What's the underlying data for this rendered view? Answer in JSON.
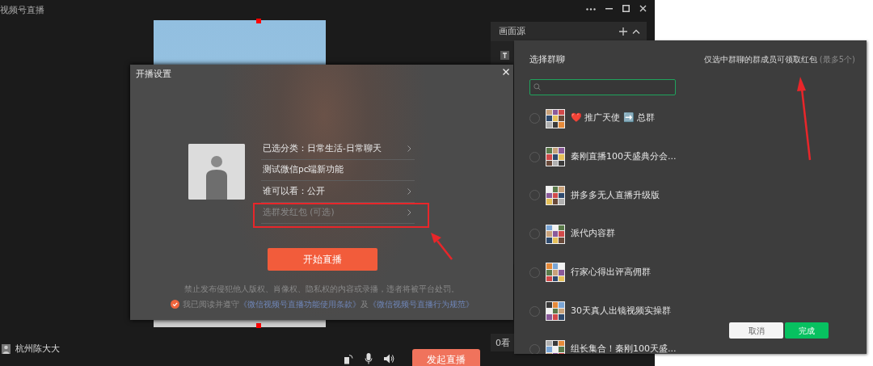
{
  "app": {
    "title": "视频号直播",
    "user_name": "杭州陈大大",
    "go_live_button": "发起直播",
    "viewers": "0看"
  },
  "sources_panel": {
    "title": "画面源"
  },
  "setup_dialog": {
    "title": "开播设置",
    "rows": [
      {
        "label": "已选分类：日常生活-日常聊天",
        "chevron": true,
        "dimmed": false
      },
      {
        "label": "测试微信pc端新功能",
        "chevron": false,
        "dimmed": false
      },
      {
        "label": "谁可以看：公开",
        "chevron": true,
        "dimmed": false
      },
      {
        "label": "选群发红包 (可选)",
        "chevron": true,
        "dimmed": true
      }
    ],
    "start_button": "开始直播",
    "notice": "禁止发布侵犯他人版权、肖像权、隐私权的内容或录播，违者将被平台处罚。",
    "agreement": {
      "checked": true,
      "text": "我已阅读并遵守",
      "links": [
        "《微信视频号直播功能使用条款》",
        "《微信视频号直播行为规范》"
      ],
      "joiner": "及"
    }
  },
  "group_picker": {
    "title": "选择群聊",
    "hint": "仅选中群聊的群成员可领取红包",
    "limit": "(最多5个)",
    "groups": [
      {
        "name": "❤️ 推广天使 ➡️ 总群",
        "selected": false
      },
      {
        "name": "秦刚直播100天盛典分会...",
        "selected": false
      },
      {
        "name": "拼多多无人直播升级版",
        "selected": false
      },
      {
        "name": "派代内容群",
        "selected": false
      },
      {
        "name": "行家心得出评高佣群",
        "selected": false
      },
      {
        "name": "30天真人出镜视频实操群",
        "selected": false
      },
      {
        "name": "组长集合！秦刚100天盛...",
        "selected": false
      }
    ],
    "buttons": {
      "cancel": "取消",
      "done": "完成"
    }
  }
}
